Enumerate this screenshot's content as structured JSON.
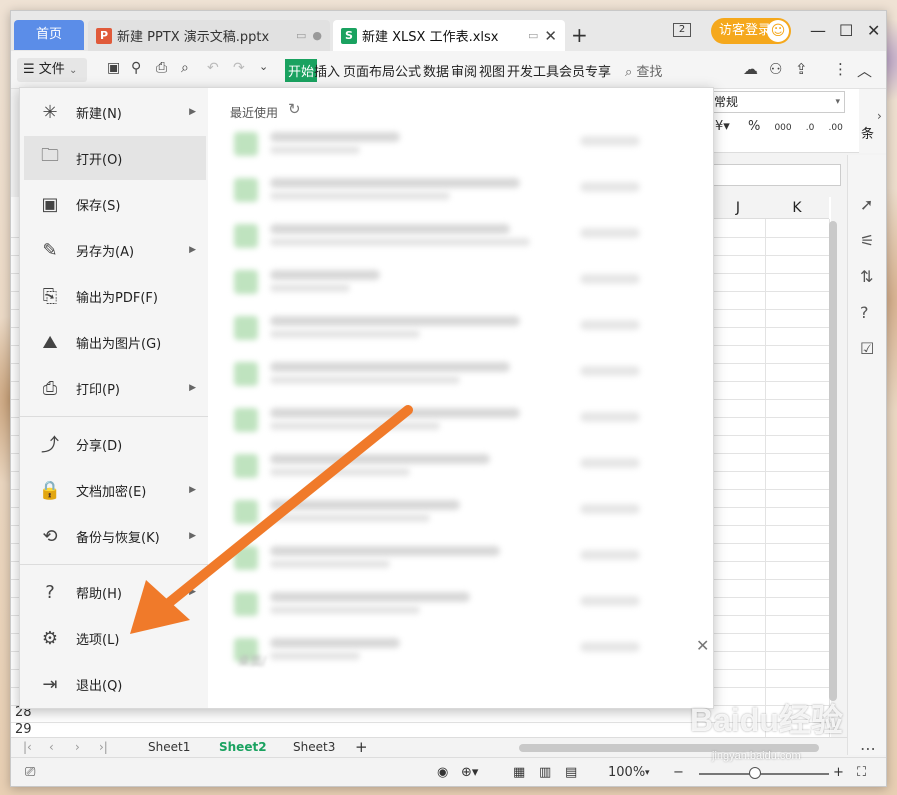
{
  "tabs": {
    "home": "首页",
    "pptx": "新建 PPTX 演示文稿.pptx",
    "xlsx": "新建 XLSX 工作表.xlsx",
    "pptx_icon": "P",
    "xlsx_icon": "S"
  },
  "titlebar": {
    "window_count": "2",
    "login_label": "访客登录"
  },
  "toolbar": {
    "file_label": "文件",
    "ribbon_tabs": [
      "开始",
      "插入",
      "页面布局",
      "公式",
      "数据",
      "审阅",
      "视图",
      "开发工具",
      "会员专享"
    ],
    "search_label": "查找"
  },
  "number_format": {
    "value": "常规",
    "cond_label": "条"
  },
  "columns": [
    "J",
    "K"
  ],
  "rows": [
    "28",
    "29"
  ],
  "file_menu": {
    "items": [
      {
        "label": "新建(N)",
        "icon": "new-icon",
        "submenu": true
      },
      {
        "label": "打开(O)",
        "icon": "open-folder-icon",
        "submenu": false
      },
      {
        "label": "保存(S)",
        "icon": "save-icon",
        "submenu": false
      },
      {
        "label": "另存为(A)",
        "icon": "save-as-icon",
        "submenu": true
      },
      {
        "label": "输出为PDF(F)",
        "icon": "pdf-export-icon",
        "submenu": false
      },
      {
        "label": "输出为图片(G)",
        "icon": "image-export-icon",
        "submenu": false
      },
      {
        "label": "打印(P)",
        "icon": "print-icon",
        "submenu": true
      },
      {
        "label": "分享(D)",
        "icon": "share-icon",
        "submenu": false
      },
      {
        "label": "文档加密(E)",
        "icon": "encrypt-icon",
        "submenu": true
      },
      {
        "label": "备份与恢复(K)",
        "icon": "backup-icon",
        "submenu": true
      },
      {
        "label": "帮助(H)",
        "icon": "help-icon",
        "submenu": true
      },
      {
        "label": "选项(L)",
        "icon": "gear-icon",
        "submenu": false
      },
      {
        "label": "退出(Q)",
        "icon": "exit-icon",
        "submenu": false
      }
    ],
    "active_item": "打开(O)",
    "recent_header": "最近使用",
    "recent_tail_text": "桌面/"
  },
  "sheets": {
    "tabs": [
      "Sheet1",
      "Sheet2",
      "Sheet3"
    ],
    "active": "Sheet2"
  },
  "status": {
    "zoom": "100%"
  },
  "watermark": {
    "brand": "Baidu经验",
    "url": "jingyan.baidu.com"
  },
  "colors": {
    "accent_blue": "#5b8de8",
    "accent_green": "#1aa260",
    "login_orange": "#f5a81c",
    "arrow_orange": "#f07a2a"
  }
}
